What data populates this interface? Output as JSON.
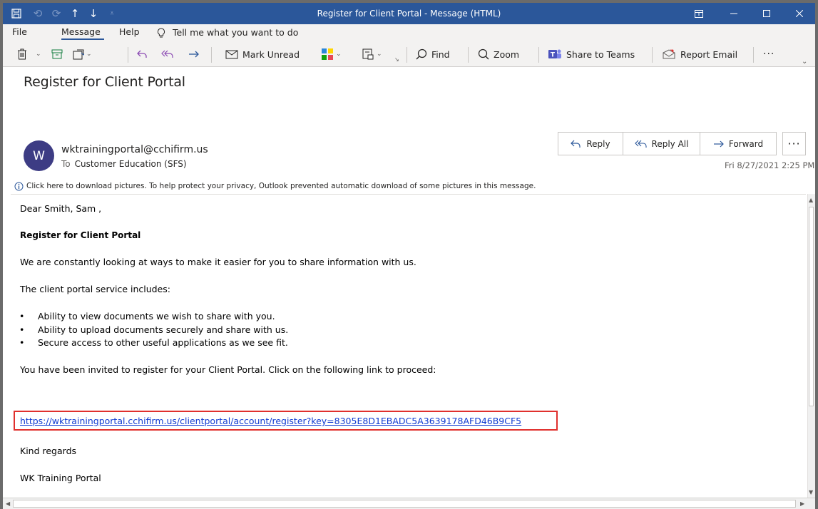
{
  "titlebar": {
    "title": "Register for Client Portal  -  Message (HTML)"
  },
  "menu": {
    "tabs": [
      "File",
      "Message",
      "Help"
    ],
    "tell_me": "Tell me what you want to do"
  },
  "toolbar": {
    "mark_unread": "Mark Unread",
    "find": "Find",
    "zoom": "Zoom",
    "share_to_teams": "Share to Teams",
    "report_email": "Report Email",
    "more": "···"
  },
  "message": {
    "subject": "Register for Client Portal",
    "avatar_initial": "W",
    "sender": "wktrainingportal@cchifirm.us",
    "to_label": "To",
    "to": "Customer Education (SFS)",
    "date": "Fri 8/27/2021 2:25 PM",
    "info_bar": "Click here to download pictures. To help protect your privacy, Outlook prevented automatic download of some pictures in this message."
  },
  "actions": {
    "reply": "Reply",
    "reply_all": "Reply All",
    "forward": "Forward",
    "more": "···"
  },
  "body": {
    "greeting": "Dear Smith, Sam ,",
    "heading": "Register for Client Portal",
    "intro": "We are constantly looking at ways to make it easier for you to share information with us.",
    "includes": "The client portal service includes:",
    "bullets": [
      "Ability to view documents we wish to share with you.",
      "Ability to upload documents securely and share with us.",
      "Secure access to other useful applications as we see fit."
    ],
    "invite": "You have been invited to register for your Client Portal. Click on the following link to proceed:",
    "link": "https://wktrainingportal.cchifirm.us/clientportal/account/register?key=8305E8D1EBADC5A3639178AFD46B9CF5",
    "closing": "Kind regards",
    "signature": "WK Training Portal"
  },
  "colors": {
    "titlebar": "#2b579a",
    "avatar": "#3d3c84",
    "link": "#0f3ad1",
    "highlight_box": "#e0302d"
  }
}
